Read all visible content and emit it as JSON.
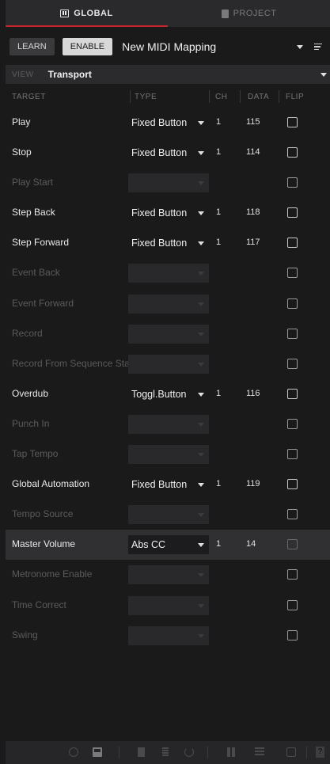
{
  "tabs": [
    {
      "label": "GLOBAL",
      "icon": "grid-icon",
      "active": true
    },
    {
      "label": "PROJECT",
      "icon": "document-icon",
      "active": false
    }
  ],
  "toolbar": {
    "learn_label": "LEARN",
    "enable_label": "ENABLE",
    "mapping_name": "New MIDI Mapping"
  },
  "view": {
    "label": "VIEW",
    "value": "Transport"
  },
  "columns": {
    "target": "TARGET",
    "type": "TYPE",
    "ch": "CH",
    "data": "DATA",
    "flip": "FLIP"
  },
  "rows": [
    {
      "target": "Play",
      "type": "Fixed Button",
      "ch": "1",
      "data": "115",
      "enabled": true
    },
    {
      "target": "Stop",
      "type": "Fixed Button",
      "ch": "1",
      "data": "114",
      "enabled": true
    },
    {
      "target": "Play Start",
      "type": "",
      "ch": "",
      "data": "",
      "enabled": false
    },
    {
      "target": "Step Back",
      "type": "Fixed Button",
      "ch": "1",
      "data": "118",
      "enabled": true
    },
    {
      "target": "Step Forward",
      "type": "Fixed Button",
      "ch": "1",
      "data": "117",
      "enabled": true
    },
    {
      "target": "Event Back",
      "type": "",
      "ch": "",
      "data": "",
      "enabled": false
    },
    {
      "target": "Event Forward",
      "type": "",
      "ch": "",
      "data": "",
      "enabled": false
    },
    {
      "target": "Record",
      "type": "",
      "ch": "",
      "data": "",
      "enabled": false
    },
    {
      "target": "Record From Sequence Sta",
      "type": "",
      "ch": "",
      "data": "",
      "enabled": false
    },
    {
      "target": "Overdub",
      "type": "Toggl.Button",
      "ch": "1",
      "data": "116",
      "enabled": true
    },
    {
      "target": "Punch In",
      "type": "",
      "ch": "",
      "data": "",
      "enabled": false
    },
    {
      "target": "Tap Tempo",
      "type": "",
      "ch": "",
      "data": "",
      "enabled": false
    },
    {
      "target": "Global Automation",
      "type": "Fixed Button",
      "ch": "1",
      "data": "119",
      "enabled": true
    },
    {
      "target": "Tempo Source",
      "type": "",
      "ch": "",
      "data": "",
      "enabled": false
    },
    {
      "target": "Master Volume",
      "type": "Abs CC",
      "ch": "1",
      "data": "14",
      "enabled": true,
      "selected": true
    },
    {
      "target": "Metronome Enable",
      "type": "",
      "ch": "",
      "data": "",
      "enabled": false
    },
    {
      "target": "Time Correct",
      "type": "",
      "ch": "",
      "data": "",
      "enabled": false
    },
    {
      "target": "Swing",
      "type": "",
      "ch": "",
      "data": "",
      "enabled": false
    }
  ],
  "footer": {
    "help_label": "?",
    "icons": [
      "circle-icon",
      "keyboard-icon",
      "document-icon",
      "bars-icon",
      "undo-icon",
      "grid-icon",
      "list-icon",
      "square-icon",
      "help-icon"
    ]
  },
  "colors": {
    "accent": "#c8242b",
    "background": "#1a1a1b",
    "panel": "#2a2a2c"
  }
}
